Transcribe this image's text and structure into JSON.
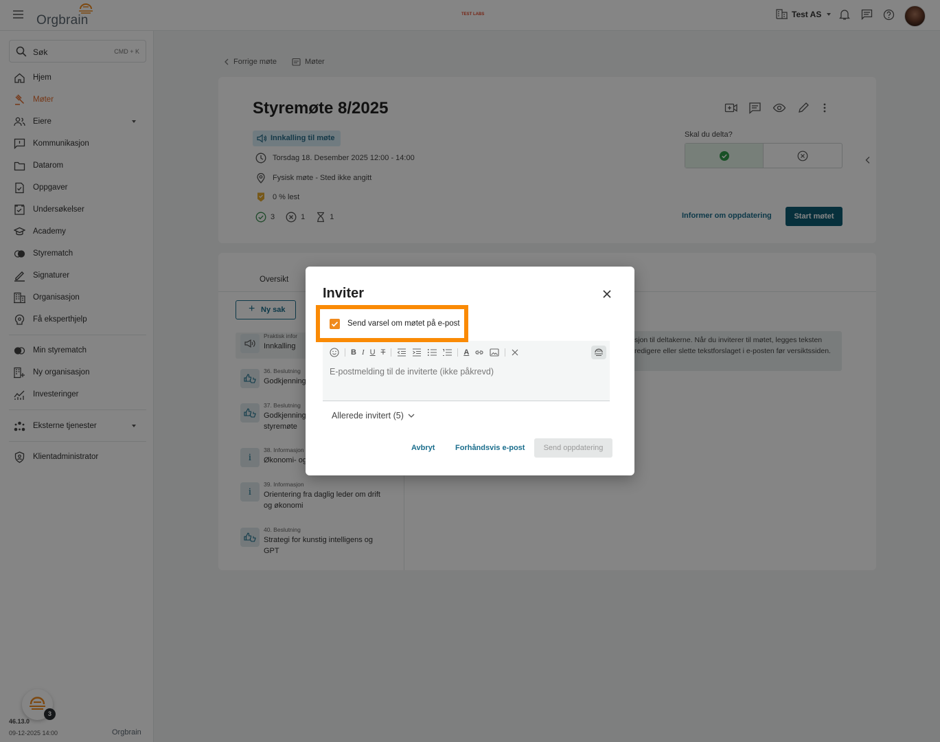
{
  "app": {
    "logo_text": "Orgbrain",
    "test_badge": "TEST LABS",
    "company": "Test AS"
  },
  "search": {
    "placeholder": "Søk",
    "shortcut": "CMD + K"
  },
  "sidebar": {
    "items": [
      {
        "label": "Hjem",
        "icon": "home-icon"
      },
      {
        "label": "Møter",
        "icon": "gavel-icon",
        "active": true
      },
      {
        "label": "Eiere",
        "icon": "people-icon",
        "expandable": true
      },
      {
        "label": "Kommunikasjon",
        "icon": "chat-icon"
      },
      {
        "label": "Datarom",
        "icon": "folder-icon"
      },
      {
        "label": "Oppgaver",
        "icon": "task-icon"
      },
      {
        "label": "Undersøkelser",
        "icon": "survey-icon"
      },
      {
        "label": "Academy",
        "icon": "academy-icon"
      },
      {
        "label": "Styrematch",
        "icon": "match-icon"
      },
      {
        "label": "Signaturer",
        "icon": "signature-icon"
      },
      {
        "label": "Organisasjon",
        "icon": "building-icon"
      },
      {
        "label": "Få eksperthjelp",
        "icon": "expert-icon"
      }
    ],
    "items2": [
      {
        "label": "Min styrematch",
        "icon": "match-icon"
      },
      {
        "label": "Ny organisasjon",
        "icon": "building-add-icon"
      },
      {
        "label": "Investeringer",
        "icon": "chart-icon"
      }
    ],
    "external": {
      "label": "Eksterne tjenester",
      "icon": "services-icon"
    },
    "admin": {
      "label": "Klientadministrator",
      "icon": "shield-icon"
    },
    "version": "46.13.0",
    "version_date": "09-12-2025 14:00",
    "footer_logo": "Orgbrain",
    "fab_badge": "3"
  },
  "breadcrumb": {
    "back": "Forrige møte",
    "meetings": "Møter"
  },
  "meeting": {
    "title": "Styremøte 8/2025",
    "chip": "Innkalling til møte",
    "date": "Torsdag 18. Desember 2025 12:00 - 14:00",
    "location": "Fysisk møte - Sted ikke angitt",
    "read": "0 % lest",
    "accepted": "3",
    "declined": "1",
    "pending": "1",
    "participate_label": "Skal du delta?",
    "inform_btn": "Informer om oppdatering",
    "start_btn": "Start møtet"
  },
  "tabs": {
    "overview": "Oversikt"
  },
  "new_case": "Ny sak",
  "agenda": [
    {
      "cat": "Praktisk infor",
      "name": "Innkalling",
      "icon": "megaphone-icon"
    },
    {
      "cat": "36. Beslutning",
      "name": "Godkjenning",
      "icon": "thumbs-icon"
    },
    {
      "cat": "37. Beslutning",
      "name": "Godkjenning styremøte",
      "icon": "thumbs-icon"
    },
    {
      "cat": "38. Informasjon",
      "name": "Økonomi- og",
      "icon": "info-icon"
    },
    {
      "cat": "39. Informasjon",
      "name": "Orientering fra daglig leder om drift og økonomi",
      "icon": "info-icon"
    },
    {
      "cat": "40. Beslutning",
      "name": "Strategi for kunstig intelligens og GPT",
      "icon": "thumbs-icon"
    }
  ],
  "info_text": "sjon til deltakerne. Når du inviterer til møtet, legges teksten redigere eller slette tekstforslaget i e-posten før versiktssiden.",
  "modal": {
    "title": "Inviter",
    "checkbox_label": "Send varsel om møtet på e-post",
    "checkbox_checked": true,
    "placeholder": "E-postmelding til de inviterte (ikke påkrevd)",
    "already_invited": "Allerede invitert (5)",
    "cancel": "Avbryt",
    "preview": "Forhåndsvis e-post",
    "send": "Send oppdatering"
  },
  "colors": {
    "accent": "#0f5c74",
    "orange": "#fa8a05",
    "link": "#1a6d8c"
  }
}
